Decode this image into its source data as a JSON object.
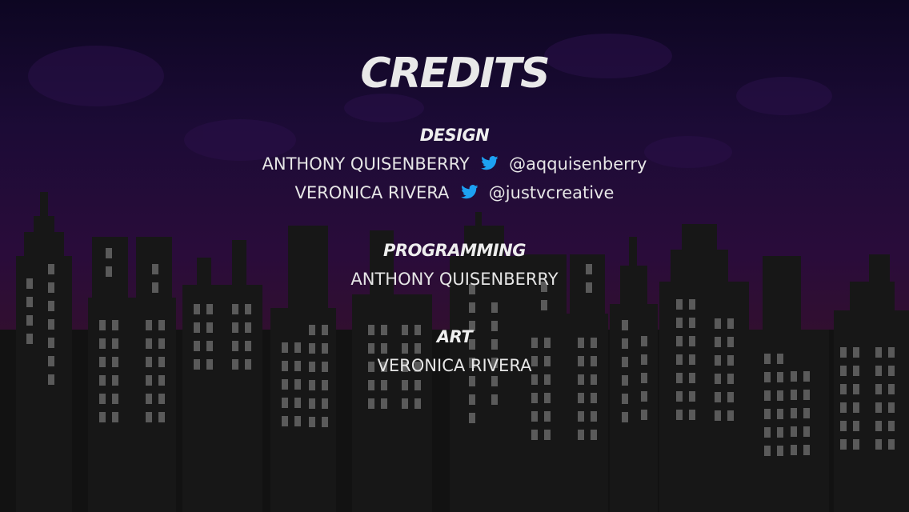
{
  "credits": {
    "title": "CREDITS",
    "sections": [
      {
        "heading": "DESIGN",
        "people": [
          {
            "name": "ANTHONY QUISENBERRY",
            "twitter": "@aqquisenberry",
            "icon": "twitter-bird-icon"
          },
          {
            "name": "VERONICA RIVERA",
            "twitter": "@justvcreative",
            "icon": "twitter-bird-icon"
          }
        ]
      },
      {
        "heading": "PROGRAMMING",
        "people": [
          {
            "name": "ANTHONY QUISENBERRY"
          }
        ]
      },
      {
        "heading": "ART",
        "people": [
          {
            "name": "VERONICA RIVERA"
          }
        ]
      }
    ]
  },
  "colors": {
    "sky_top": "#0d0622",
    "sky_bottom": "#34102c",
    "building": "#171717",
    "window": "#5a5a5a",
    "text": "#e9e9e9",
    "twitter_blue": "#1da1f2"
  }
}
